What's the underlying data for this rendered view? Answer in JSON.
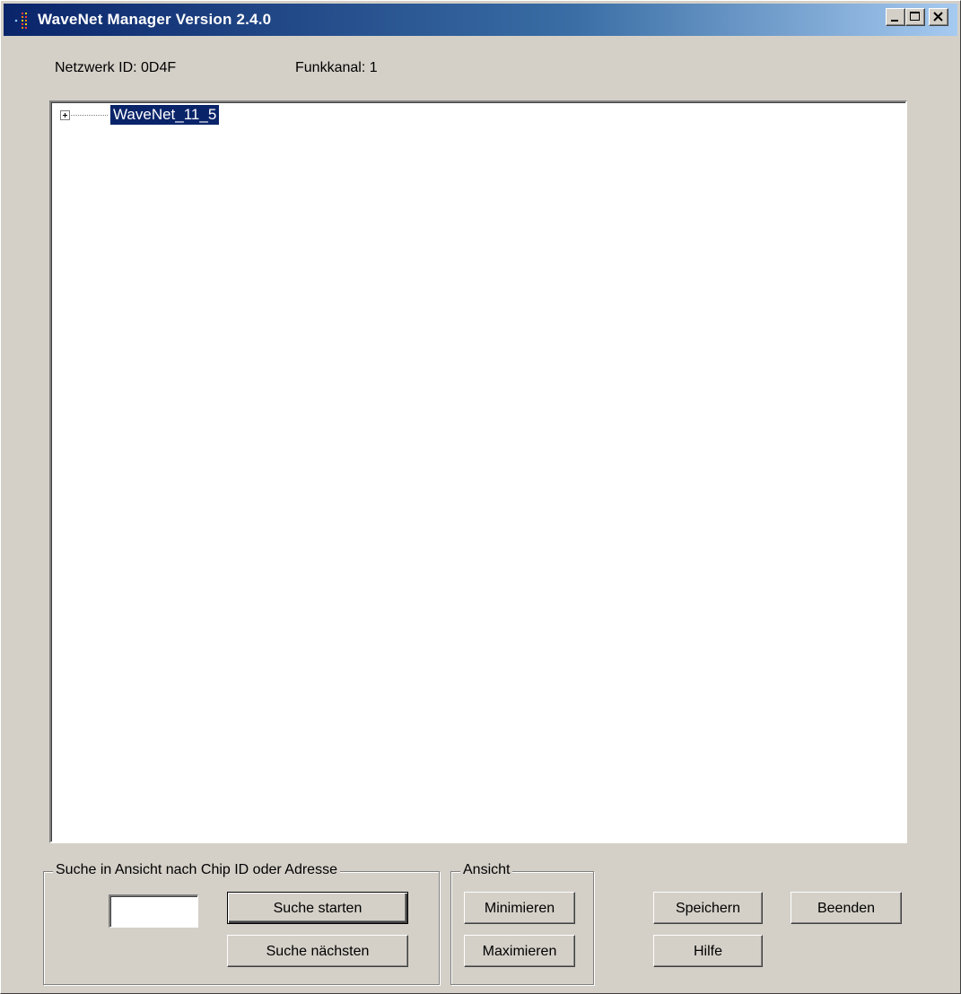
{
  "window": {
    "title": "WaveNet Manager Version 2.4.0"
  },
  "info": {
    "network_id": "Netzwerk ID: 0D4F",
    "radio_channel": "Funkkanal: 1"
  },
  "tree": {
    "nodes": [
      {
        "label": "WaveNet_11_5",
        "expanded": false,
        "selected": true
      }
    ]
  },
  "search_group": {
    "caption": "Suche in Ansicht nach Chip ID oder Adresse",
    "input_value": "",
    "start_label": "Suche starten",
    "next_label": "Suche nächsten"
  },
  "view_group": {
    "caption": "Ansicht",
    "minimize_label": "Minimieren",
    "maximize_label": "Maximieren"
  },
  "actions": {
    "save_label": "Speichern",
    "exit_label": "Beenden",
    "help_label": "Hilfe"
  },
  "colors": {
    "title_gradient_start": "#0a246a",
    "title_gradient_end": "#a6caf0",
    "selection": "#0a246a",
    "face": "#d4d0c8"
  },
  "icons": {
    "app": "wavenet-app-icon",
    "minimize": "minimize-icon",
    "maximize": "maximize-icon",
    "close": "close-icon",
    "expand": "plus-expand-icon"
  }
}
